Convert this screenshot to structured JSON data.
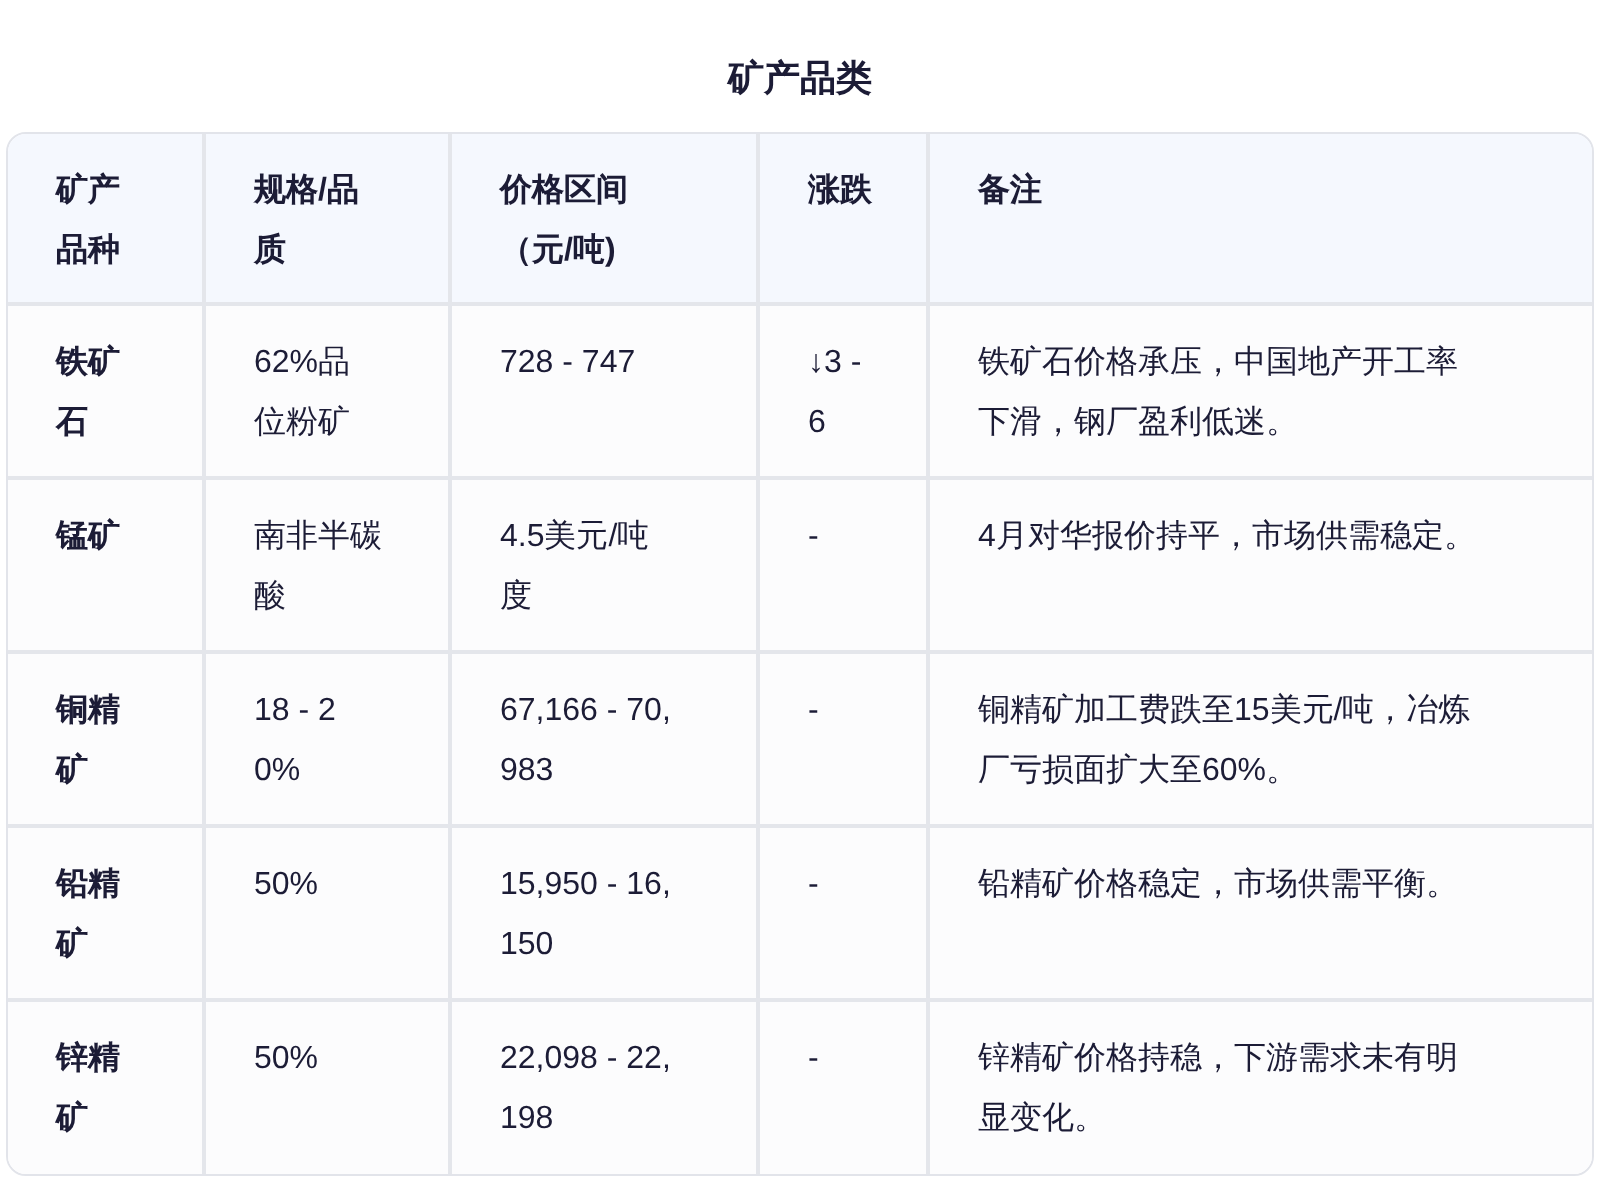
{
  "title": "矿产品类",
  "table": {
    "columns": [
      "矿产品种",
      "规格/品质",
      "价格区间（元/吨)",
      "涨跌",
      "备注"
    ],
    "rows": [
      {
        "cells": [
          "铁矿石",
          "62%品位粉矿",
          "728 - 747",
          "↓3 - 6",
          "铁矿石价格承压，中国地产开工率下滑，钢厂盈利低迷。"
        ]
      },
      {
        "cells": [
          "锰矿",
          "南非半碳酸",
          "4.5美元/吨度",
          "-",
          "4月对华报价持平，市场供需稳定。"
        ]
      },
      {
        "cells": [
          "铜精矿",
          "18 - 20%",
          "67,166 - 70,983",
          "-",
          "铜精矿加工费跌至15美元/吨，冶炼厂亏损面扩大至60%。"
        ]
      },
      {
        "cells": [
          "铅精矿",
          "50%",
          "15,950 - 16,150",
          "-",
          "铅精矿价格稳定，市场供需平衡。"
        ]
      },
      {
        "cells": [
          "锌精矿",
          "50%",
          "22,098 - 22,198",
          "-",
          "锌精矿价格持稳，下游需求未有明显变化。"
        ]
      }
    ]
  }
}
